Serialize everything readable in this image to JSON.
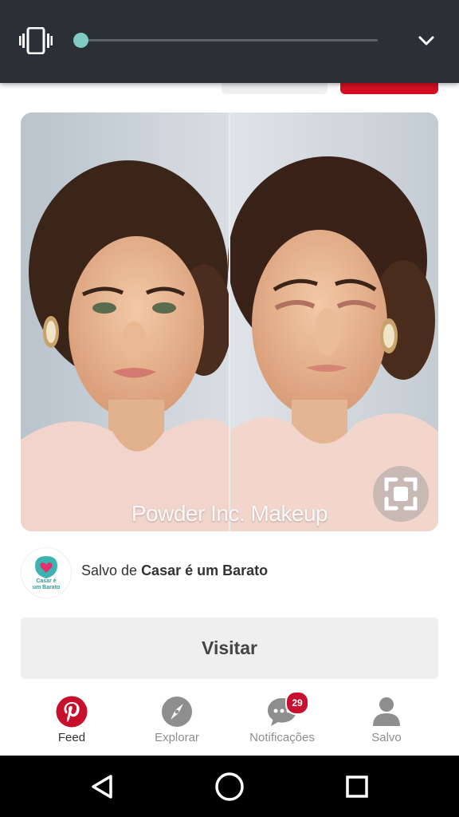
{
  "volume_panel": {
    "level": 0.02,
    "icons": [
      "vibrate-icon",
      "chevron-down-icon"
    ],
    "accent_color": "#80cbc4"
  },
  "pin": {
    "watermark": "Powder Inc. Makeup",
    "visual_search_icon": "visual-search-icon"
  },
  "source": {
    "prefix": "Salvo de ",
    "name": "Casar é um Barato",
    "avatar_text_line1": "Casar é",
    "avatar_text_line2": "um Barato"
  },
  "visit_button": {
    "label": "Visitar"
  },
  "tabs": [
    {
      "label": "Feed",
      "icon": "pinterest-icon",
      "active": true
    },
    {
      "label": "Explorar",
      "icon": "compass-icon"
    },
    {
      "label": "Notificações",
      "icon": "chat-bubble-icon",
      "badge": "29"
    },
    {
      "label": "Salvo",
      "icon": "person-icon"
    }
  ],
  "colors": {
    "brand_red": "#e60023",
    "badge_red": "#c8102e"
  }
}
